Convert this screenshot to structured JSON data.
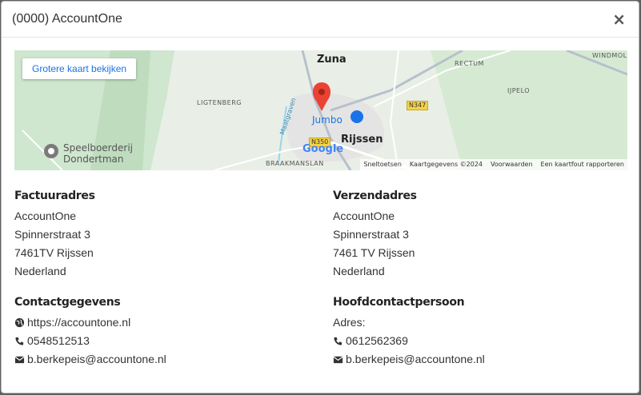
{
  "modal": {
    "title": "(0000) AccountOne",
    "close_label": "×"
  },
  "map": {
    "button_label": "Grotere kaart bekijken",
    "labels": {
      "zuna": "Zuna",
      "rectum": "RECTUM",
      "windmolen": "WINDMOL",
      "ligtenberg": "LIGTENBERG",
      "ijpelo": "IJPELO",
      "jumbo": "Jumbo",
      "rijssen": "Rijssen",
      "speelboerderij_1": "Speelboerderij",
      "speelboerderij_2": "Dondertman",
      "braakmanslanden": "BRAAKMANSLAN",
      "maatgraven": "Maatgraven"
    },
    "roads": {
      "n347": "N347",
      "n350": "N350"
    },
    "google": "Google",
    "attribution": {
      "shortcuts": "Sneltoetsen",
      "data": "Kaartgegevens ©2024",
      "terms": "Voorwaarden",
      "report": "Een kaartfout rapporteren"
    }
  },
  "billing": {
    "title": "Factuuradres",
    "lines": [
      "AccountOne",
      "Spinnerstraat 3",
      "7461TV Rijssen",
      "Nederland"
    ]
  },
  "shipping": {
    "title": "Verzendadres",
    "lines": [
      "AccountOne",
      "Spinnerstraat 3",
      "7461 TV Rijssen",
      "Nederland"
    ]
  },
  "contact": {
    "title": "Contactgegevens",
    "website": "https://accountone.nl",
    "phone": "0548512513",
    "email": "b.berkepeis@accountone.nl"
  },
  "main_contact": {
    "title": "Hoofdcontactpersoon",
    "address_label": "Adres:",
    "phone": "0612562369",
    "email": "b.berkepeis@accountone.nl"
  },
  "colors": {
    "link": "#1a73e8",
    "pin": "#ea4335",
    "map_bg": "#e9efe6"
  }
}
